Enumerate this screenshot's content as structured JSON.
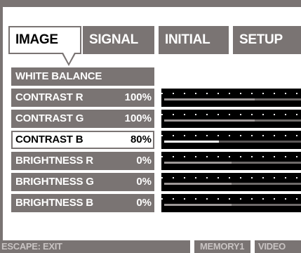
{
  "tabs": [
    {
      "label": "IMAGE",
      "active": true
    },
    {
      "label": "SIGNAL",
      "active": false
    },
    {
      "label": "INITIAL",
      "active": false
    },
    {
      "label": "SETUP",
      "active": false
    }
  ],
  "menu": {
    "header": "WHITE BALANCE",
    "items": [
      {
        "label": "CONTRAST R",
        "value": "100%",
        "level": 0.66,
        "selected": false
      },
      {
        "label": "CONTRAST G",
        "value": "100%",
        "level": 0.66,
        "selected": false
      },
      {
        "label": "CONTRAST B",
        "value": "80%",
        "level": 0.4,
        "selected": true
      },
      {
        "label": "BRIGHTNESS R",
        "value": "0%",
        "level": 0.49,
        "selected": false
      },
      {
        "label": "BRIGHTNESS G",
        "value": "0%",
        "level": 0.49,
        "selected": false
      },
      {
        "label": "BRIGHTNESS B",
        "value": "0%",
        "level": 0.49,
        "selected": false
      }
    ]
  },
  "footer": {
    "escape": "ESCAPE: EXIT",
    "memory": "MEMORY1",
    "source": "VIDEO"
  },
  "colors": {
    "frame": "#7a7473",
    "panel": "#ffffff",
    "bar_bg": "#000000",
    "bar_fill": "#9d9897",
    "bar_fill_selected": "#ffffff"
  }
}
